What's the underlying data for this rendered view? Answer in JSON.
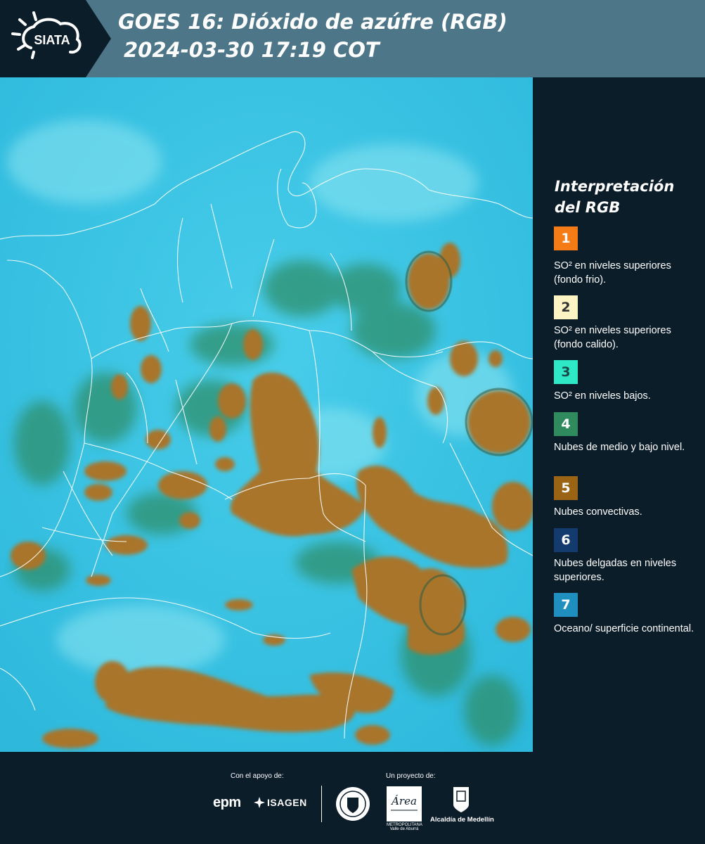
{
  "header": {
    "logo": "SIATA",
    "title_line1": "GOES 16: Dióxido de azúfre (RGB)",
    "title_line2": "2024-03-30 17:19 COT"
  },
  "map": {
    "background_color": "#3cc8e6",
    "convective_cloud_color": "#a8742a",
    "low_cloud_color": "#2e8f6a",
    "boundary_color": "#ffffff"
  },
  "legend": {
    "title": "Interpretación del RGB",
    "items": [
      {
        "number": "1",
        "color": "#f47b16",
        "text_color": "#ffffff",
        "label": "SO² en niveles superiores (fondo frio)."
      },
      {
        "number": "2",
        "color": "#fdf4c4",
        "text_color": "#333333",
        "label": "SO² en niveles superiores (fondo calido)."
      },
      {
        "number": "3",
        "color": "#2ee8c6",
        "text_color": "#1a4a4a",
        "label": "SO² en niveles bajos."
      },
      {
        "number": "4",
        "color": "#2f8a5e",
        "text_color": "#ffffff",
        "label": "Nubes de medio y bajo nivel."
      },
      {
        "number": "5",
        "color": "#9a6414",
        "text_color": "#ffffff",
        "label": "Nubes convectivas."
      },
      {
        "number": "6",
        "color": "#143b6e",
        "text_color": "#ffffff",
        "label": "Nubes delgadas en niveles superiores."
      },
      {
        "number": "7",
        "color": "#1f8fbf",
        "text_color": "#ffffff",
        "label": "Oceano/ superficie continental."
      }
    ]
  },
  "footer": {
    "support_caption": "Con el apoyo de:",
    "project_caption": "Un proyecto de:",
    "sponsors": [
      "epm",
      "ISAGEN"
    ],
    "area_logo": "Área",
    "area_logo_sub": "METROPOLITANA Valle de Aburrá",
    "alcaldia": "Alcaldía de Medellín"
  }
}
